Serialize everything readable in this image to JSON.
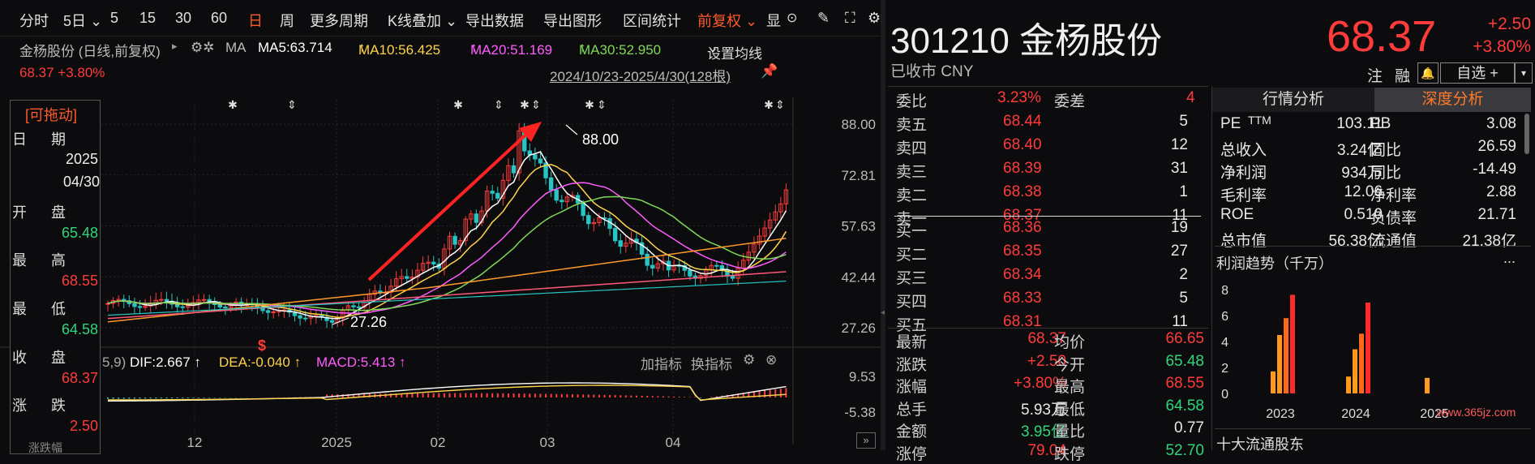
{
  "toolbar": {
    "items": [
      "分时",
      "5日",
      "5",
      "15",
      "30",
      "60",
      "日",
      "周",
      "更多周期",
      "K线叠加",
      "导出数据",
      "导出图形",
      "区间统计",
      "前复权",
      "显"
    ],
    "selected_index": 6
  },
  "info": {
    "stock_line": "金杨股份 (日线,前复权)",
    "ma_label": "MA",
    "ma5": "MA5:63.714",
    "ma10": "MA10:56.425",
    "ma20": "MA20:51.169",
    "ma30": "MA30:52.950",
    "set_ma": "设置均线",
    "price_change": "68.37 +3.80%",
    "date_range": "2024/10/23-2025/4/30(128根)"
  },
  "chart": {
    "y_labels": [
      "88.00",
      "72.81",
      "57.63",
      "42.44",
      "27.26"
    ],
    "high_label": "88.00",
    "low_label": "27.26",
    "x_labels": [
      "12",
      "2025",
      "02",
      "03",
      "04"
    ],
    "macd_line": "5,9)",
    "dif": "DIF:2.667",
    "dea": "DEA:-0.040",
    "macd": "MACD:5.413",
    "add_indicator": "加指标",
    "switch_indicator": "换指标",
    "macd_y": [
      "9.53",
      "-5.38"
    ]
  },
  "popup": {
    "title": "[可拖动]",
    "date_k": "日",
    "date_k2": "期",
    "year": "2025",
    "md": "04/30",
    "open_k": "开",
    "open_k2": "盘",
    "open": "65.48",
    "high_k": "最",
    "high_k2": "高",
    "high": "68.55",
    "low_k": "最",
    "low_k2": "低",
    "low": "64.58",
    "close_k": "收",
    "close_k2": "盘",
    "close": "68.37",
    "chg_k": "涨",
    "chg_k2": "跌",
    "chg": "2.50",
    "more": "涨跌幅"
  },
  "header": {
    "code": "301210",
    "name": "金杨股份",
    "status": "已收市 CNY",
    "price": "68.37",
    "change": "+2.50",
    "pct": "+3.80%",
    "btn_note": "注",
    "btn_margin": "融",
    "btn_select": "自选 +"
  },
  "orderbook": {
    "weibi_label": "委比",
    "weibi": "3.23%",
    "weicha_label": "委差",
    "weicha": "4",
    "asks": [
      {
        "label": "卖五",
        "price": "68.44",
        "vol": "5"
      },
      {
        "label": "卖四",
        "price": "68.40",
        "vol": "12"
      },
      {
        "label": "卖三",
        "price": "68.39",
        "vol": "31"
      },
      {
        "label": "卖二",
        "price": "68.38",
        "vol": "1"
      },
      {
        "label": "卖一",
        "price": "68.37",
        "vol": "11"
      }
    ],
    "bids": [
      {
        "label": "买一",
        "price": "68.36",
        "vol": "19"
      },
      {
        "label": "买二",
        "price": "68.35",
        "vol": "27"
      },
      {
        "label": "买三",
        "price": "68.34",
        "vol": "2"
      },
      {
        "label": "买四",
        "price": "68.33",
        "vol": "5"
      },
      {
        "label": "买五",
        "price": "68.31",
        "vol": "11"
      }
    ]
  },
  "stats": [
    {
      "l1": "最新",
      "v1": "68.37",
      "c1": "up",
      "l2": "均价",
      "v2": "66.65",
      "c2": "up"
    },
    {
      "l1": "涨跌",
      "v1": "+2.50",
      "c1": "up",
      "l2": "今开",
      "v2": "65.48",
      "c2": "dn"
    },
    {
      "l1": "涨幅",
      "v1": "+3.80%",
      "c1": "up",
      "l2": "最高",
      "v2": "68.55",
      "c2": "up"
    },
    {
      "l1": "总手",
      "v1": "5.93万",
      "c1": "wh",
      "l2": "最低",
      "v2": "64.58",
      "c2": "dn"
    },
    {
      "l1": "金额",
      "v1": "3.95亿",
      "c1": "dn",
      "l2": "量比",
      "v2": "0.77",
      "c2": "wh"
    },
    {
      "l1": "涨停",
      "v1": "79.04",
      "c1": "up",
      "l2": "跌停",
      "v2": "52.70",
      "c2": "dn"
    }
  ],
  "analysis": {
    "tab1": "行情分析",
    "tab2": "深度分析",
    "rows": [
      {
        "l1": "PE",
        "l1s": "TTM",
        "v1": "103.11",
        "l2": "PB",
        "v2": "3.08"
      },
      {
        "l1": "总收入",
        "l1s": "",
        "v1": "3.24亿",
        "l2": "同比",
        "v2": "26.59"
      },
      {
        "l1": "净利润",
        "l1s": "",
        "v1": "934万",
        "l2": "同比",
        "v2": "-14.49"
      },
      {
        "l1": "毛利率",
        "l1s": "",
        "v1": "12.06",
        "l2": "净利率",
        "v2": "2.88"
      },
      {
        "l1": "ROE",
        "l1s": "",
        "v1": "0.510",
        "l2": "负债率",
        "v2": "21.71"
      },
      {
        "l1": "总市值",
        "l1s": "",
        "v1": "56.38亿",
        "l2": "流通值",
        "v2": "21.38亿"
      }
    ],
    "profit_title": "利润趋势（千万）",
    "more": "...",
    "top10": "十大流通股东",
    "watermark": "www.365jz.com"
  },
  "chart_data": {
    "type": "bar",
    "title": "利润趋势（千万）",
    "categories": [
      "2023",
      "2024",
      "2025"
    ],
    "ylim": [
      0,
      8
    ],
    "y_ticks": [
      "8",
      "6",
      "4",
      "2",
      "0"
    ],
    "series": [
      {
        "group": "2023",
        "values": [
          1.7,
          4.5,
          5.8,
          7.6
        ]
      },
      {
        "group": "2024",
        "values": [
          1.3,
          3.4,
          4.6,
          7.0
        ]
      },
      {
        "group": "2025",
        "values": [
          1.2
        ]
      }
    ]
  },
  "colors": {
    "up": "#ff3b3b",
    "down": "#2fd57a",
    "ma5": "#ffffff",
    "ma10": "#ffd34a",
    "ma20": "#ff5cff",
    "ma30": "#7ed957"
  }
}
